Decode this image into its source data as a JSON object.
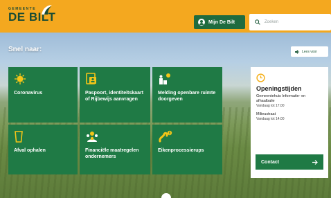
{
  "header": {
    "logo_small": "GEMEENTE",
    "logo_big": "DE BILT",
    "account_button": "Mijn De Bilt",
    "search_placeholder": "Zoeken"
  },
  "colors": {
    "header_bg": "#f4a81f",
    "tile_green": "#1f7a45",
    "button_green": "#1f6b3f",
    "tile_icon_yellow": "#f5c518"
  },
  "quick": {
    "title": "Snel naar:",
    "read_aloud": "Lees voor",
    "tiles": [
      {
        "label": "Coronavirus",
        "icon": "virus-icon"
      },
      {
        "label": "Paspoort, identiteitskaart of Rijbewijs aanvragen",
        "icon": "id-card-icon"
      },
      {
        "label": "Melding openbare ruimte doorgeven",
        "icon": "report-icon"
      },
      {
        "label": "Afval ophalen",
        "icon": "bin-icon"
      },
      {
        "label": "Financiële maatregelen ondernemers",
        "icon": "finance-icon"
      },
      {
        "label": "Eikenprocessierups",
        "icon": "caterpillar-icon"
      }
    ]
  },
  "hours": {
    "title": "Openingstijden",
    "loc1": "Gemeentehuis Informatie- en afhaalbalie",
    "loc1_time": "Vandaag tot 17.00",
    "loc2": "Milieustraat",
    "loc2_time": "Vandaag tot 14.00",
    "contact": "Contact"
  }
}
